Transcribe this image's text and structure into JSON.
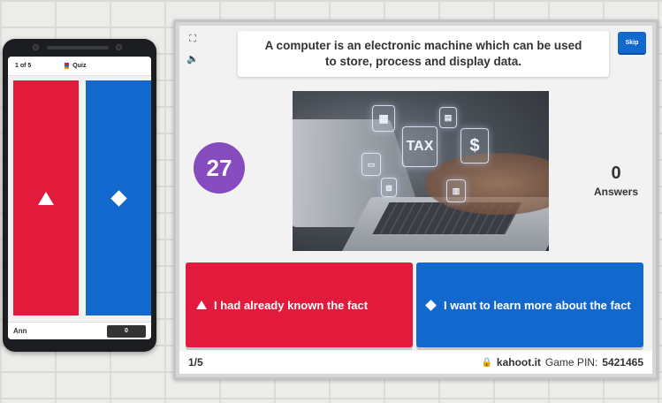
{
  "phone": {
    "progress": "1 of 5",
    "mode_label": "Quiz",
    "player_name": "Ann",
    "player_score": "0"
  },
  "host": {
    "question": "A computer is an electronic machine which can be used to store, process and display data.",
    "skip_label": "Skip",
    "timer": "27",
    "answers_count": "0",
    "answers_label": "Answers",
    "image_overlay": {
      "tax_text": "TAX",
      "dollar_text": "$"
    },
    "options": [
      {
        "shape": "triangle-icon",
        "color": "#e21b3c",
        "label": "I had already known the fact"
      },
      {
        "shape": "diamond-icon",
        "color": "#1368ce",
        "label": "I want to learn more about the fact"
      }
    ],
    "footer": {
      "progress": "1/5",
      "site": "kahoot.it",
      "pin_label": "Game PIN:",
      "pin": "5421465"
    }
  },
  "colors": {
    "red": "#e21b3c",
    "blue": "#1368ce",
    "purple": "#864cbf"
  }
}
